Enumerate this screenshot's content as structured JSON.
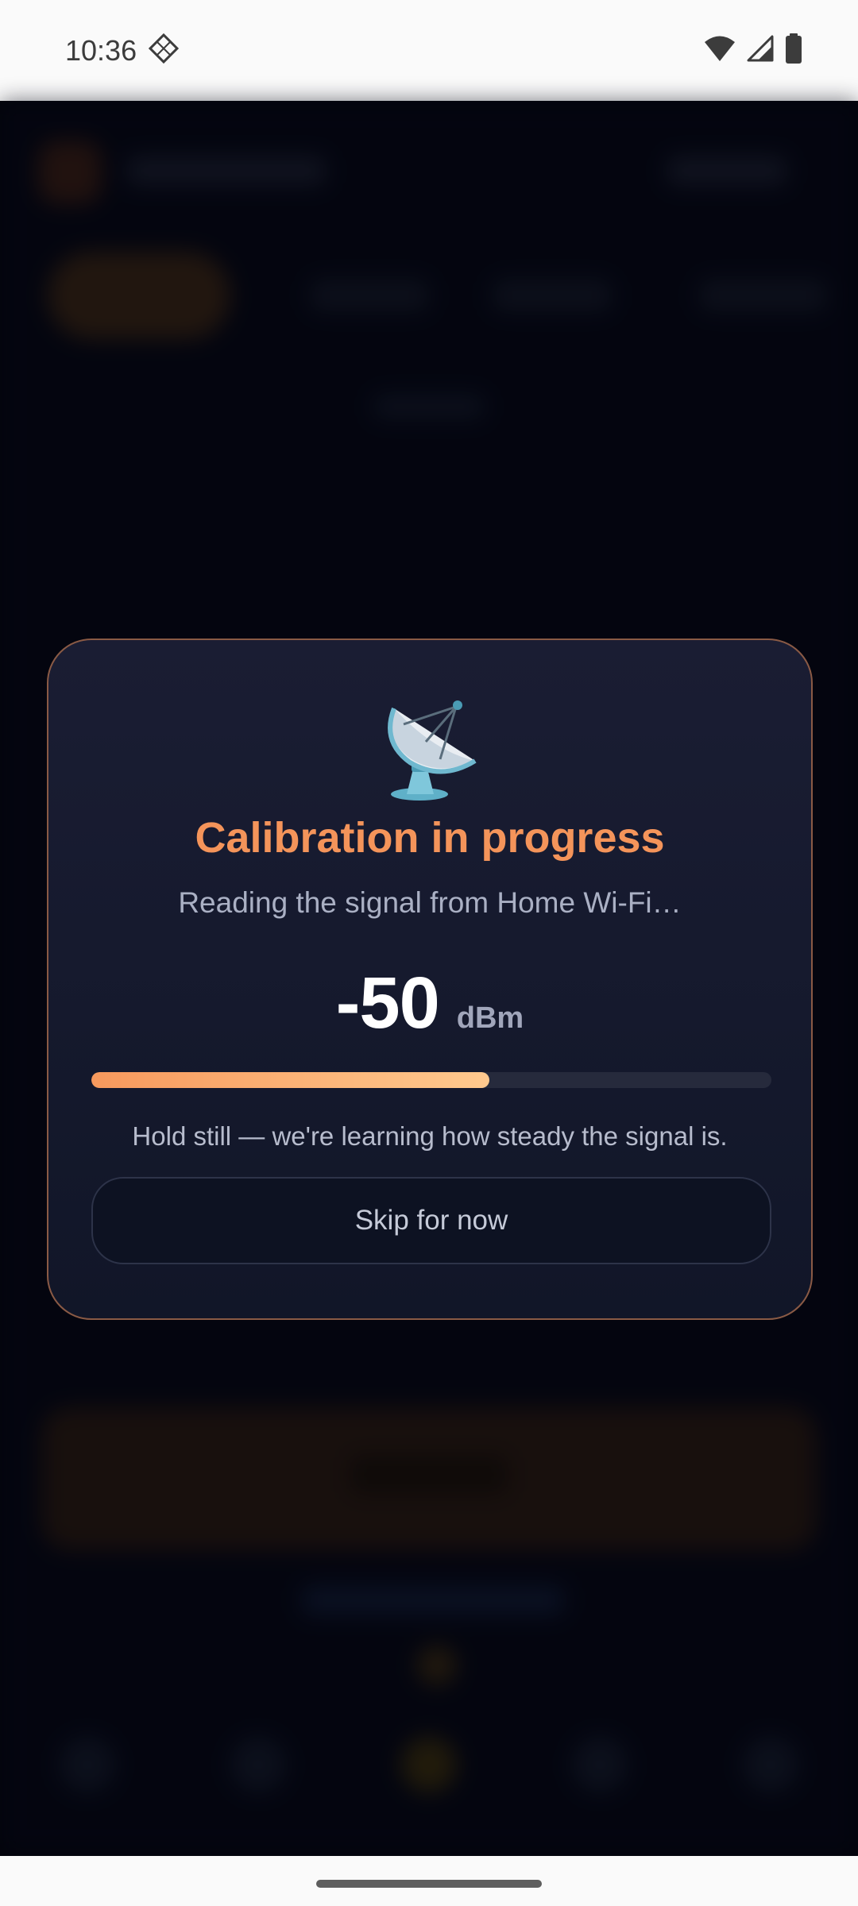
{
  "status_bar": {
    "time": "10:36",
    "icons": [
      "assistant-icon",
      "wifi-icon",
      "cellular-signal-icon",
      "battery-icon"
    ]
  },
  "calibration_dialog": {
    "icon": "satellite-antenna-icon",
    "title": "Calibration in progress",
    "subtitle": "Reading the signal from Home Wi-Fi…",
    "reading_value": "-50",
    "reading_unit": "dBm",
    "progress_fraction": 0.585,
    "hint": "Hold still — we're learning how steady the signal is.",
    "skip_label": "Skip for now"
  },
  "colors": {
    "accent": "#f4945a",
    "progress_start": "#f7995d",
    "progress_end": "#ffc98e",
    "dialog_border": "#8a5a45",
    "dialog_background": "#1a1d33",
    "backdrop": "#03040b"
  }
}
